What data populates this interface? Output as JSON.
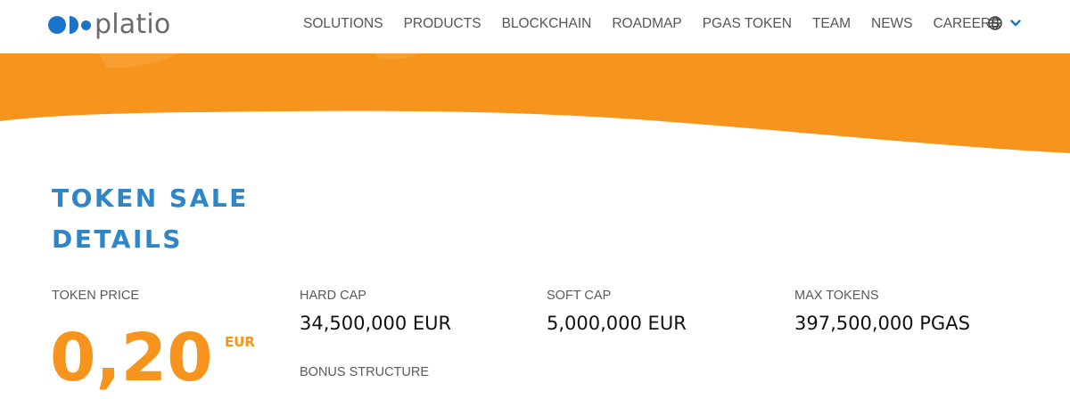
{
  "brand": {
    "name": "platio",
    "accent_color": "#1a73c8",
    "orange_color": "#f7941d",
    "title_color": "#2e86c6"
  },
  "nav": {
    "items": [
      {
        "label": "SOLUTIONS"
      },
      {
        "label": "PRODUCTS"
      },
      {
        "label": "BLOCKCHAIN"
      },
      {
        "label": "ROADMAP"
      },
      {
        "label": "PGAS TOKEN"
      },
      {
        "label": "TEAM"
      },
      {
        "label": "NEWS"
      },
      {
        "label": "CAREERS"
      }
    ],
    "language_icon": "globe-icon",
    "dropdown_icon": "chevron-down-icon"
  },
  "section": {
    "title_line1": "TOKEN SALE",
    "title_line2": "DETAILS"
  },
  "token_price": {
    "label": "TOKEN PRICE",
    "value": "0,20",
    "unit": "EUR"
  },
  "stats": [
    {
      "label": "HARD CAP",
      "value": "34,500,000 EUR"
    },
    {
      "label": "SOFT CAP",
      "value": "5,000,000 EUR"
    },
    {
      "label": "MAX TOKENS",
      "value": "397,500,000 PGAS"
    }
  ],
  "bonus": {
    "label": "BONUS STRUCTURE"
  }
}
